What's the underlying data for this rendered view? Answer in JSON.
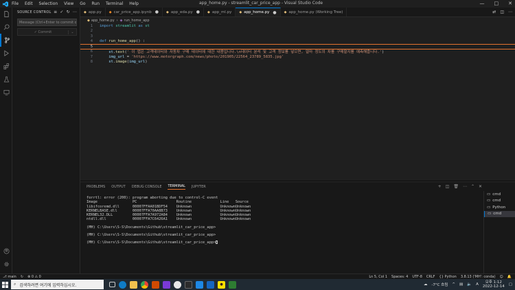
{
  "titlebar": {
    "menus": [
      "File",
      "Edit",
      "Selection",
      "View",
      "Go",
      "Run",
      "Terminal",
      "Help"
    ],
    "title": "app_home.py - streamlit_car_price_app - Visual Studio Code"
  },
  "sidebar": {
    "header": "SOURCE CONTROL",
    "message_placeholder": "Message (Ctrl+Enter to commit on ...",
    "commit_label": "✓ Commit"
  },
  "tabs": [
    {
      "label": "app.py",
      "modified": false
    },
    {
      "label": "car_price_app.ipynb",
      "modified": true
    },
    {
      "label": "app_eda.py",
      "modified": true
    },
    {
      "label": "app_ml.py",
      "modified": false
    },
    {
      "label": "app_home.py",
      "modified": true,
      "active": true
    },
    {
      "label": "app_home.py (Working Tree)",
      "modified": false
    }
  ],
  "breadcrumb": {
    "file": "app_home.py",
    "separator": "›",
    "symbol": "run_home_app"
  },
  "code": {
    "l1": {
      "n": "1",
      "kw": "import",
      "mod": "streamlit",
      "as": "as",
      "alias": "st"
    },
    "l2": {
      "n": "2"
    },
    "l3": {
      "n": "3"
    },
    "l4": {
      "n": "4",
      "kw": "def",
      "fn": "run_home_app",
      "tail": "() :"
    },
    "l5": {
      "n": "5"
    },
    "l6": {
      "n": "6",
      "obj": "st",
      "fn": "text",
      "str": "' 이 앱은 고객데이터와 자동차 구매 데이터에 대한 내용입니다.\\n데이터 분석 및 고객 정보를 넣으면, 얼마 정도의 차를 구매할지를 예측해줍니다.'"
    },
    "l7": {
      "n": "7",
      "var": "img_url",
      "eq": "=",
      "str": "'https://www.motorgraph.com/news/photo/201905/22564_23789_5835.jpg'"
    },
    "l8": {
      "n": "8",
      "obj": "st",
      "fn": "image",
      "arg": "img_url"
    }
  },
  "panel": {
    "tabs": [
      "PROBLEMS",
      "OUTPUT",
      "DEBUG CONSOLE",
      "TERMINAL",
      "JUPYTER"
    ],
    "active_tab": "TERMINAL",
    "terminal": {
      "error": "forrtl: error (200): program aborting due to control-C event",
      "header": [
        "Image",
        "PC",
        "Routine",
        "Line",
        "Source"
      ],
      "rows": [
        [
          "libifcoremd.dll",
          "00007FFAA01BDF54",
          "Unknown",
          "Unknown",
          "Unknown"
        ],
        [
          "KERNELBASE.dll",
          "00007FFA70AA8B73",
          "Unknown",
          "Unknown",
          "Unknown"
        ],
        [
          "KERNEL32.DLL",
          "00007FFA7A972A84",
          "Unknown",
          "Unknown",
          "Unknown"
        ],
        [
          "ntdll.dll",
          "00007FFA7C6426A1",
          "Unknown",
          "Unknown",
          "Unknown"
        ]
      ],
      "prompts": [
        "(MH) C:\\Users\\S-S\\Documents\\Github\\streamlit_car_price_app>",
        "(MH) C:\\Users\\S-S\\Documents\\Github\\streamlit_car_price_app>",
        "(MH) C:\\Users\\S-S\\Documents\\Github\\streamlit_car_price_app>"
      ]
    },
    "terminal_list": [
      "cmd",
      "cmd",
      "Python",
      "cmd"
    ]
  },
  "status": {
    "branch": "main",
    "errors": "⊗ 0 ⚠ 0",
    "position": "Ln 5, Col 1",
    "spaces": "Spaces: 4",
    "encoding": "UTF-8",
    "eol": "CRLF",
    "language": "{} Python",
    "interpreter": "3.8.13 ('MH': conda)"
  },
  "taskbar": {
    "search_placeholder": "검색하려면 여기에 입력하십시오.",
    "weather": "-7°C 흐림",
    "time": "오후 1:12",
    "date": "2022-12-14"
  },
  "colors": {
    "accent": "#0078d4",
    "modified_border": "#e2722f"
  }
}
